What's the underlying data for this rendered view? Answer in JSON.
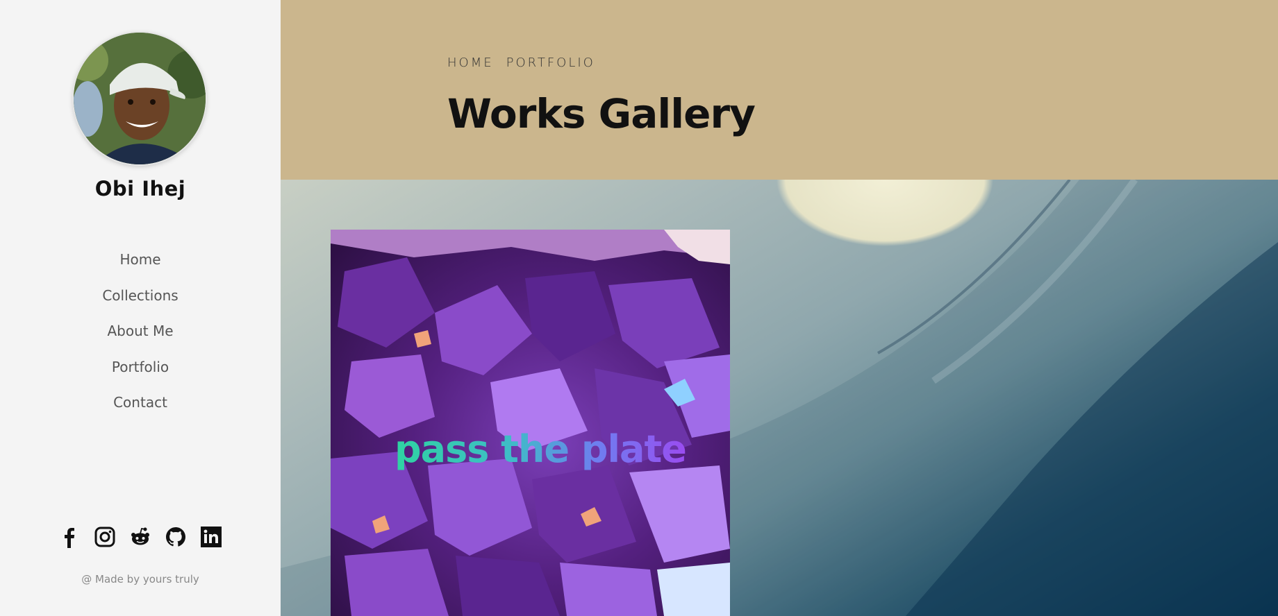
{
  "profile": {
    "name": "Obi Ihej"
  },
  "nav": {
    "items": [
      {
        "label": "Home"
      },
      {
        "label": "Collections"
      },
      {
        "label": "About Me"
      },
      {
        "label": "Portfolio"
      },
      {
        "label": "Contact"
      }
    ]
  },
  "socials": [
    {
      "icon": "facebook-icon"
    },
    {
      "icon": "instagram-icon"
    },
    {
      "icon": "reddit-icon"
    },
    {
      "icon": "github-icon"
    },
    {
      "icon": "linkedin-icon"
    }
  ],
  "footer": {
    "text": "@ Made by yours truly"
  },
  "header": {
    "breadcrumb": [
      "HOME",
      "PORTFOLIO"
    ],
    "title": "Works Gallery"
  },
  "gallery": {
    "items": [
      {
        "title": "pass the plate"
      }
    ]
  },
  "colors": {
    "header_bg": "#cbb68d",
    "sidebar_bg": "#f4f4f4"
  }
}
